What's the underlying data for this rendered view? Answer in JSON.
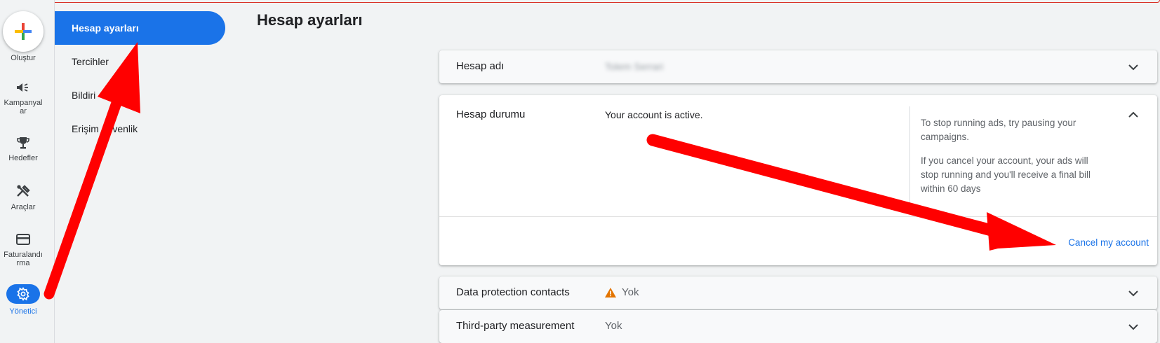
{
  "rail": {
    "create": "Oluştur",
    "items": [
      {
        "label": "Kampanyal ar",
        "icon": "megaphone-icon"
      },
      {
        "label": "Hedefler",
        "icon": "trophy-icon"
      },
      {
        "label": "Araçlar",
        "icon": "tools-icon"
      },
      {
        "label": "Faturalandı rma",
        "icon": "credit-card-icon"
      },
      {
        "label": "Yönetici",
        "icon": "gear-icon"
      }
    ]
  },
  "subnav": {
    "items": [
      {
        "label": "Hesap ayarları",
        "active": true
      },
      {
        "label": "Tercihler"
      },
      {
        "label": "Bildiri"
      },
      {
        "label": "Erişim  güvenlik"
      }
    ]
  },
  "page": {
    "title": "Hesap ayarları"
  },
  "cards": {
    "account_name": {
      "title": "Hesap adı",
      "value": "Tolem Serrari"
    },
    "account_status": {
      "title": "Hesap durumu",
      "status": "Your account is active.",
      "info1": "To stop running ads, try pausing your campaigns.",
      "info2": "If you cancel your account, your ads will stop running and you'll receive a final bill within 60 days",
      "cancel": "Cancel my account"
    },
    "data_protection": {
      "title": "Data protection contacts",
      "value": "Yok"
    },
    "third_party": {
      "title": "Third-party measurement",
      "value": "Yok"
    }
  },
  "colors": {
    "accent": "#1a73e8",
    "annotation": "#ff0000",
    "warning": "#e37400"
  }
}
